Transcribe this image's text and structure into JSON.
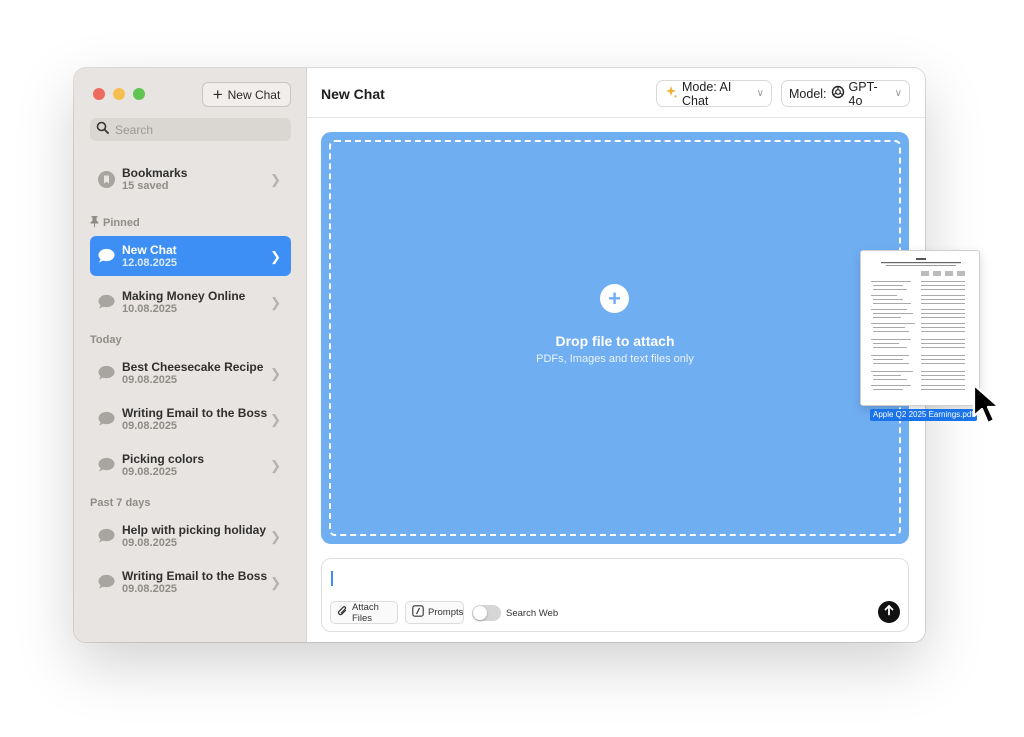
{
  "sidebar": {
    "new_chat_label": "New Chat",
    "search_placeholder": "Search",
    "bookmarks": {
      "title": "Bookmarks",
      "sub": "15 saved"
    },
    "sections": {
      "pinned": "Pinned",
      "today": "Today",
      "past": "Past 7 days"
    },
    "pinned_items": [
      {
        "title": "New Chat",
        "date": "12.08.2025"
      },
      {
        "title": "Making Money Online",
        "date": "10.08.2025"
      }
    ],
    "today_items": [
      {
        "title": "Best Cheesecake Recipe",
        "date": "09.08.2025"
      },
      {
        "title": "Writing Email to the Boss",
        "date": "09.08.2025"
      },
      {
        "title": "Picking colors",
        "date": "09.08.2025"
      }
    ],
    "past_items": [
      {
        "title": "Help with picking holiday",
        "date": "09.08.2025"
      },
      {
        "title": "Writing Email to the Boss",
        "date": "09.08.2025"
      }
    ]
  },
  "header": {
    "title": "New Chat",
    "mode_label": "Mode: AI Chat",
    "model_label": "Model:",
    "model_value": "GPT-4o"
  },
  "dropzone": {
    "title": "Drop file to attach",
    "subtitle": "PDFs, Images and text files only"
  },
  "composer": {
    "attach_label": "Attach Files",
    "prompts_label": "Prompts",
    "search_web_label": "Search Web",
    "search_web_enabled": false
  },
  "dragged_file": {
    "name": "Apple Q2 2025 Earnings.pdf"
  },
  "colors": {
    "accent": "#3d8ff5",
    "dropzone": "#70aef2"
  }
}
